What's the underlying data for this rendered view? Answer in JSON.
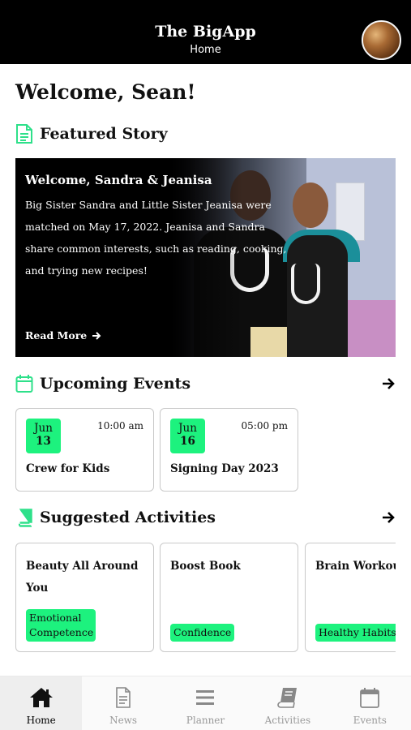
{
  "header": {
    "title": "The BigApp",
    "subtitle": "Home"
  },
  "welcome": "Welcome, Sean!",
  "featured": {
    "heading": "Featured Story",
    "title": "Welcome, Sandra & Jeanisa",
    "body": "Big Sister Sandra and Little Sister Jeanisa were matched on May 17, 2022. Jeanisa and Sandra share common interests, such as reading, cooking, and trying new recipes!",
    "read_more": "Read More"
  },
  "events": {
    "heading": "Upcoming Events",
    "items": [
      {
        "month": "Jun",
        "day": "13",
        "time": "10:00 am",
        "name": "Crew for Kids"
      },
      {
        "month": "Jun",
        "day": "16",
        "time": "05:00 pm",
        "name": "Signing Day 2023"
      }
    ]
  },
  "activities": {
    "heading": "Suggested Activities",
    "items": [
      {
        "name": "Beauty All Around You",
        "tag": "Emotional Competence"
      },
      {
        "name": "Boost Book",
        "tag": "Confidence"
      },
      {
        "name": "Brain Workout",
        "tag": "Healthy Habits"
      }
    ]
  },
  "nav": {
    "items": [
      {
        "label": "Home",
        "icon": "home-icon",
        "active": true
      },
      {
        "label": "News",
        "icon": "news-icon"
      },
      {
        "label": "Planner",
        "icon": "planner-icon"
      },
      {
        "label": "Activities",
        "icon": "activities-icon"
      },
      {
        "label": "Events",
        "icon": "events-icon"
      }
    ]
  },
  "colors": {
    "accent": "#1df27e",
    "header_bg": "#000000",
    "icon_accent": "#2ee08a"
  }
}
